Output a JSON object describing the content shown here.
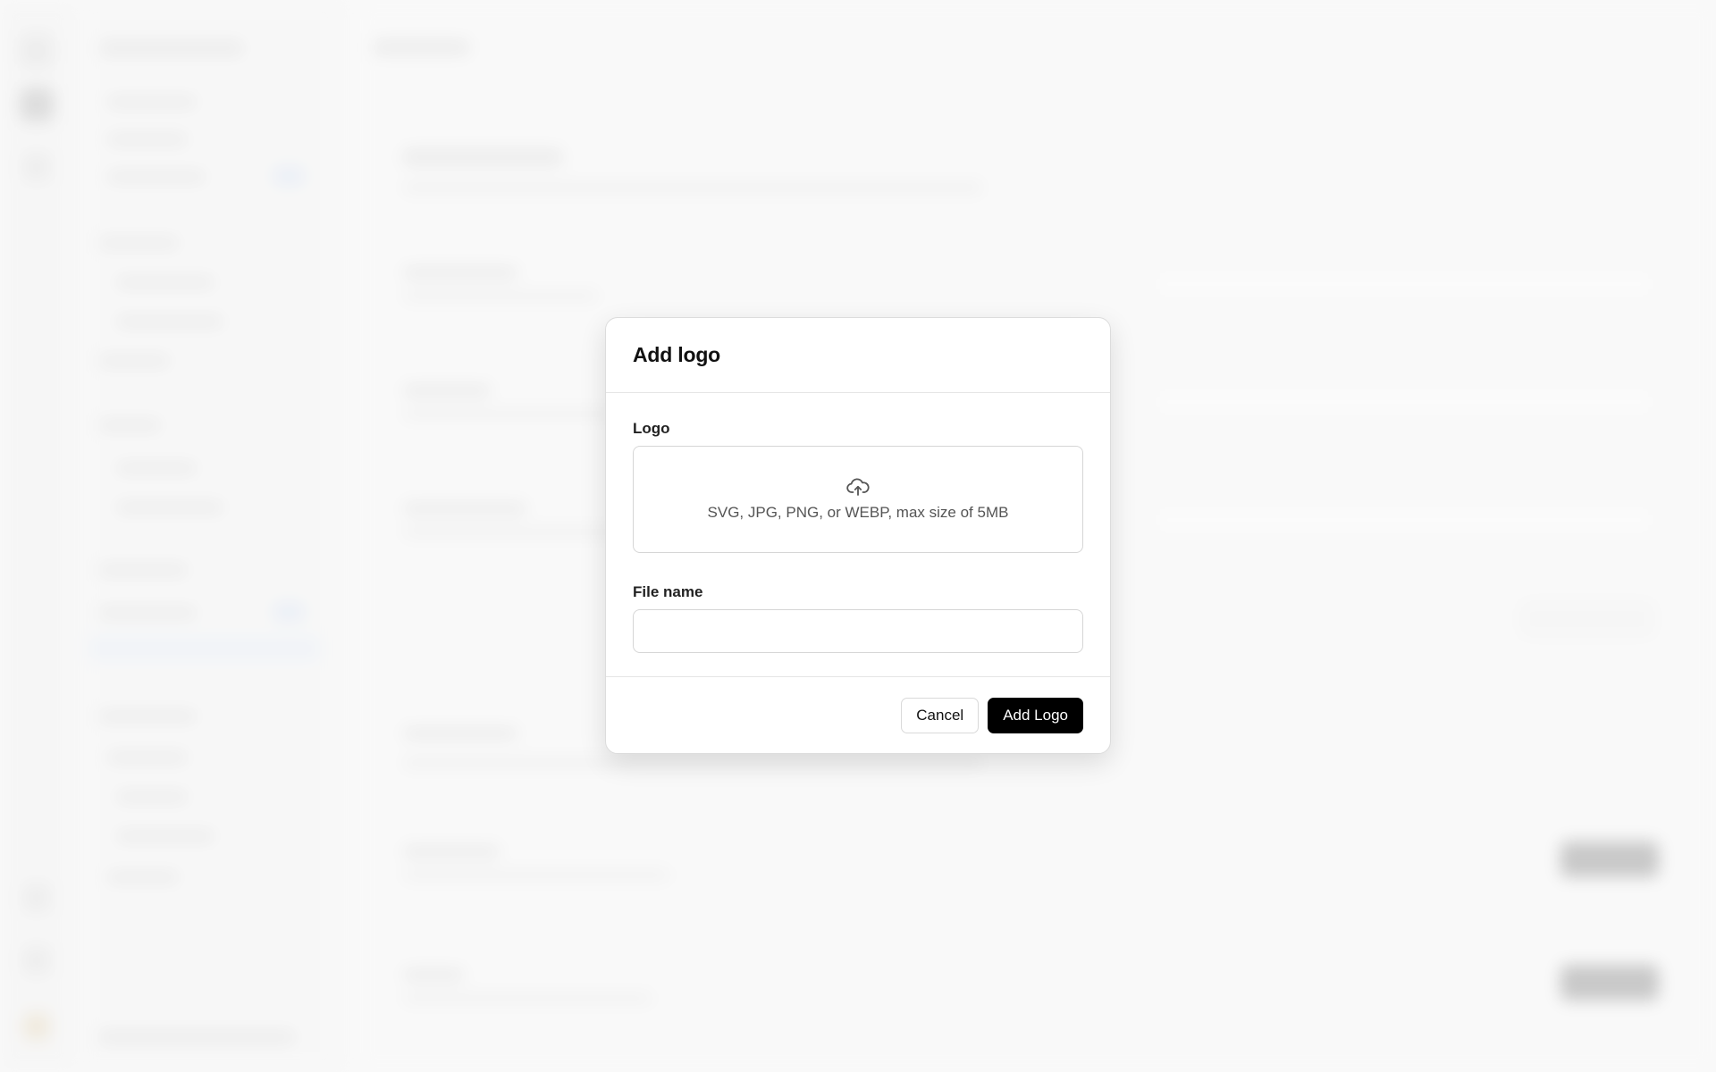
{
  "dialog": {
    "title": "Add logo",
    "logo_label": "Logo",
    "dropzone_icon": "cloud-upload-icon",
    "dropzone_hint": "SVG, JPG, PNG, or WEBP, max size of 5MB",
    "file_name_label": "File name",
    "file_name_value": "",
    "cancel_label": "Cancel",
    "submit_label": "Add Logo"
  },
  "colors": {
    "primary_button": "#000000",
    "overlay": "#ffffff"
  }
}
